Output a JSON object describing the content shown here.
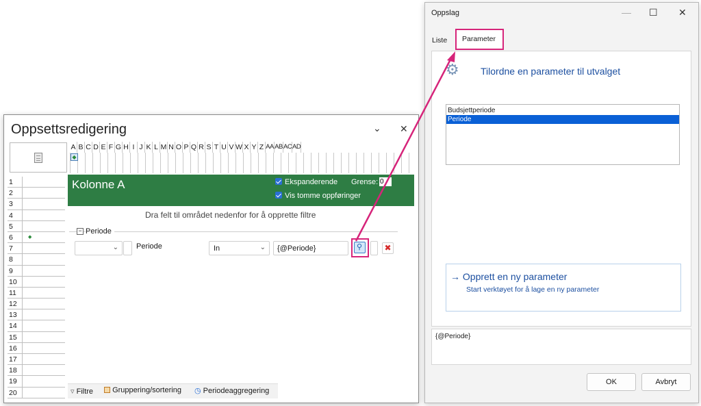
{
  "editor": {
    "title": "Oppsettsredigering",
    "columns": [
      "A",
      "B",
      "C",
      "D",
      "E",
      "F",
      "G",
      "H",
      "I",
      "J",
      "K",
      "L",
      "M",
      "N",
      "O",
      "P",
      "Q",
      "R",
      "S",
      "T",
      "U",
      "V",
      "W",
      "X",
      "Y",
      "Z",
      "AA",
      "AB",
      "AC",
      "AD"
    ],
    "rows": [
      "1",
      "2",
      "3",
      "4",
      "5",
      "6",
      "7",
      "8",
      "9",
      "10",
      "11",
      "12",
      "13",
      "14",
      "15",
      "16",
      "17",
      "18",
      "19",
      "20"
    ],
    "column_title": "Kolonne A",
    "expand_label": "Ekspanderende",
    "limit_label": "Grense:",
    "limit_value": "0",
    "show_empty_label": "Vis tomme oppføringer",
    "drop_hint": "Dra felt til området nedenfor for å opprette filtre",
    "group_label": "Periode",
    "filter_field": "Periode",
    "operator": "In",
    "filter_value": "{@Periode}",
    "tabs": [
      "Filtre",
      "Gruppering/sortering",
      "Periodeaggregering"
    ]
  },
  "lookup": {
    "title": "Oppslag",
    "tabs": [
      "Liste",
      "Parameter"
    ],
    "heading": "Tilordne en parameter til utvalget",
    "items": [
      "Budsjettperiode",
      "Periode"
    ],
    "selected_index": 1,
    "create_title": "Opprett en ny parameter",
    "create_sub": "Start verktøyet for å lage en ny parameter",
    "expression": "{@Periode}",
    "ok": "OK",
    "cancel": "Avbryt"
  },
  "colors": {
    "accent": "#0a60d6",
    "highlight": "#d6247a",
    "header_green": "#2e7d44"
  }
}
